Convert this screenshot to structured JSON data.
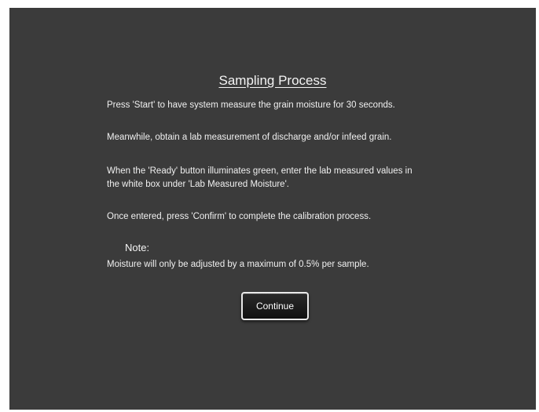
{
  "dialog": {
    "title": "Sampling Process",
    "paragraphs": [
      "Press 'Start' to have system measure the grain moisture for 30 seconds.",
      "Meanwhile, obtain a lab measurement of discharge and/or infeed grain.",
      "When the 'Ready' button illuminates green, enter the lab measured values in\nthe white box under 'Lab Measured Moisture'.",
      "Once entered, press 'Confirm' to complete the calibration process."
    ],
    "note_heading": "Note:",
    "note_text": "Moisture will only be adjusted by a maximum of 0.5% per sample.",
    "continue_label": "Continue"
  },
  "colors": {
    "background": "#3b3b3b",
    "text": "#f0f0f0",
    "button_fill": "#1a1a1a",
    "button_border": "#e9e9e9"
  }
}
